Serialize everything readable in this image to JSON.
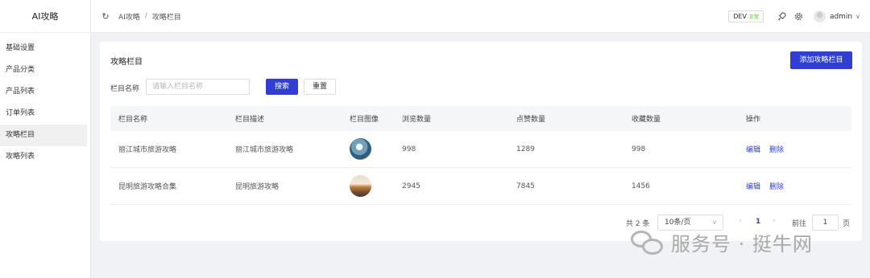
{
  "sidebar": {
    "logo": "AI攻略",
    "items": [
      {
        "label": "基础设置"
      },
      {
        "label": "产品分类"
      },
      {
        "label": "产品列表"
      },
      {
        "label": "订单列表"
      },
      {
        "label": "攻略栏目",
        "active": true
      },
      {
        "label": "攻略列表"
      }
    ]
  },
  "header": {
    "refresh_icon": "refresh-icon",
    "breadcrumb": [
      "AI攻略",
      "攻略栏目"
    ],
    "breadcrumb_sep": "/",
    "env_label": "DEV",
    "env_status": "正常",
    "user": "admin"
  },
  "page": {
    "title": "攻略栏目",
    "add_button": "添加攻略栏目",
    "filter": {
      "label": "栏目名称",
      "placeholder": "请输入栏目名称",
      "search_button": "搜索",
      "reset_button": "重置"
    }
  },
  "table": {
    "columns": [
      "栏目名称",
      "栏目描述",
      "栏目图像",
      "浏览数量",
      "点赞数量",
      "收藏数量",
      "操作"
    ],
    "rows": [
      {
        "name": "丽江城市旅游攻略",
        "desc": "丽江城市旅游攻略",
        "views": "998",
        "likes": "1289",
        "favorites": "998",
        "edit": "编辑",
        "delete": "删除"
      },
      {
        "name": "昆明旅游攻略合集",
        "desc": "昆明旅游攻略",
        "views": "2945",
        "likes": "7845",
        "favorites": "1456",
        "edit": "编辑",
        "delete": "删除"
      }
    ]
  },
  "pagination": {
    "total": "共 2 条",
    "page_size": "10条/页",
    "current_page": "1",
    "goto_label": "前往",
    "goto_value": "1",
    "page_suffix": "页"
  },
  "watermark": {
    "text": "服务号 · 挺牛网"
  },
  "colors": {
    "primary": "#2f3fd6",
    "status_ok": "#52c41a"
  }
}
